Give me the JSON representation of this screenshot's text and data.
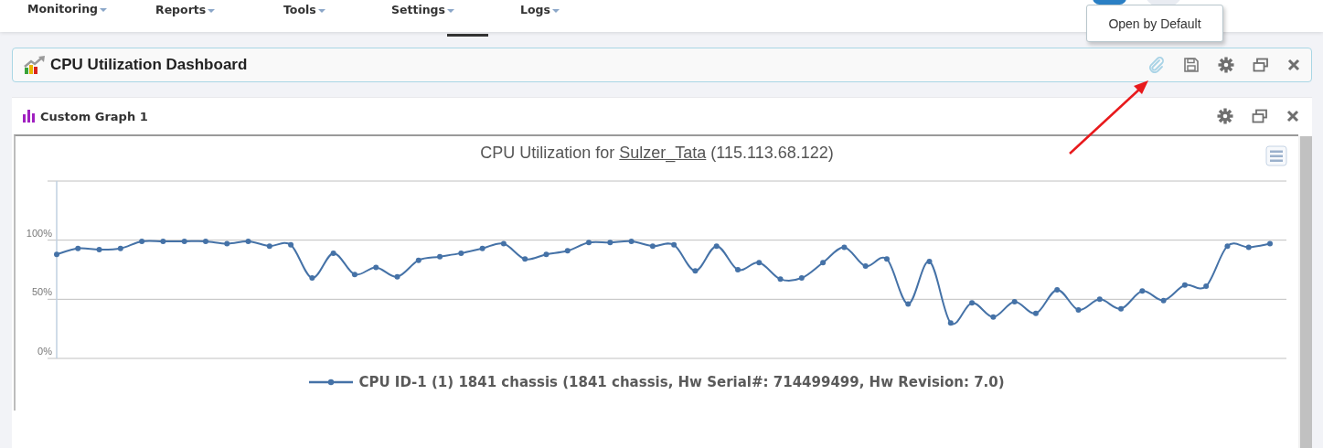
{
  "nav": {
    "items": [
      {
        "label": "Monitoring"
      },
      {
        "label": "Reports"
      },
      {
        "label": "Tools"
      },
      {
        "label": "Settings"
      },
      {
        "label": "Logs"
      }
    ]
  },
  "tooltip": {
    "text": "Open by Default"
  },
  "dashboard": {
    "title": "CPU Utilization Dashboard"
  },
  "panel": {
    "title": "Custom Graph 1",
    "chart_title": {
      "prefix": "CPU Utilization for ",
      "link": "Sulzer_Tata",
      "suffix": " (115.113.68.122)"
    },
    "chart_data": {
      "type": "line",
      "ylim": [
        0,
        150
      ],
      "yticks": [
        {
          "value": 0,
          "label": "0%"
        },
        {
          "value": 50,
          "label": "50%"
        },
        {
          "value": 100,
          "label": "100%"
        }
      ],
      "series": [
        {
          "name": "CPU ID-1 (1) 1841 chassis (1841 chassis, Hw Serial#: 714499499, Hw Revision: 7.0)",
          "color": "#4572a7",
          "marker": "circle",
          "values": [
            88,
            93,
            92,
            93,
            99,
            99,
            99,
            99,
            97,
            99,
            95,
            96,
            68,
            89,
            71,
            77,
            69,
            83,
            86,
            89,
            93,
            97,
            84,
            88,
            91,
            98,
            98,
            99,
            95,
            96,
            74,
            95,
            75,
            81,
            67,
            68,
            81,
            94,
            78,
            84,
            46,
            82,
            30,
            47,
            35,
            48,
            38,
            58,
            41,
            50,
            42,
            57,
            49,
            62,
            61,
            95,
            94,
            97
          ]
        }
      ]
    }
  }
}
